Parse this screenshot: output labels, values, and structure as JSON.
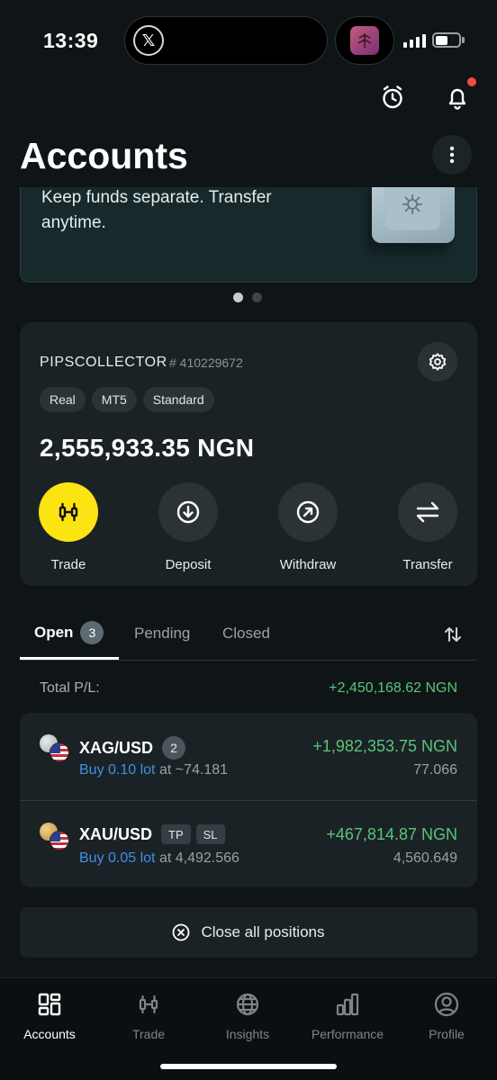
{
  "status_bar": {
    "time": "13:39"
  },
  "header": {
    "title": "Accounts"
  },
  "banner": {
    "text": "Keep funds separate. Transfer anytime.",
    "page_index": 1,
    "page_count": 2
  },
  "account": {
    "name": "PIPSCOLLECTOR",
    "number": "# 410229672",
    "tags": [
      "Real",
      "MT5",
      "Standard"
    ],
    "balance": "2,555,933.35 NGN",
    "actions": [
      {
        "label": "Trade",
        "icon": "candlestick-icon",
        "primary": true
      },
      {
        "label": "Deposit",
        "icon": "arrow-down-circle-icon"
      },
      {
        "label": "Withdraw",
        "icon": "arrow-up-right-circle-icon"
      },
      {
        "label": "Transfer",
        "icon": "transfer-arrows-icon"
      }
    ]
  },
  "tabs": [
    {
      "label": "Open",
      "count": "3",
      "active": true
    },
    {
      "label": "Pending"
    },
    {
      "label": "Closed"
    }
  ],
  "total_pl": {
    "label": "Total P/L:",
    "value": "+2,450,168.62 NGN"
  },
  "positions": [
    {
      "symbol": "XAG/USD",
      "badge": "2",
      "side_lot": "Buy 0.10 lot",
      "at_price": "at ~74.181",
      "pl": "+1,982,353.75 NGN",
      "current_price": "77.066",
      "coin": "silver"
    },
    {
      "symbol": "XAU/USD",
      "tags": [
        "TP",
        "SL"
      ],
      "side_lot": "Buy 0.05 lot",
      "at_price": "at 4,492.566",
      "pl": "+467,814.87 NGN",
      "current_price": "4,560.649",
      "coin": "gold"
    }
  ],
  "close_all_label": "Close all positions",
  "bottom_nav": [
    {
      "label": "Accounts",
      "icon": "accounts-grid-icon",
      "active": true
    },
    {
      "label": "Trade",
      "icon": "candlestick-icon"
    },
    {
      "label": "Insights",
      "icon": "globe-icon"
    },
    {
      "label": "Performance",
      "icon": "bar-chart-icon"
    },
    {
      "label": "Profile",
      "icon": "profile-icon"
    }
  ],
  "colors": {
    "background": "#0f1416",
    "card": "#1b2226",
    "accent_yellow": "#fce312",
    "profit_green": "#5ac47a",
    "buy_blue": "#3f8fe6",
    "notification_red": "#ef4b44"
  }
}
